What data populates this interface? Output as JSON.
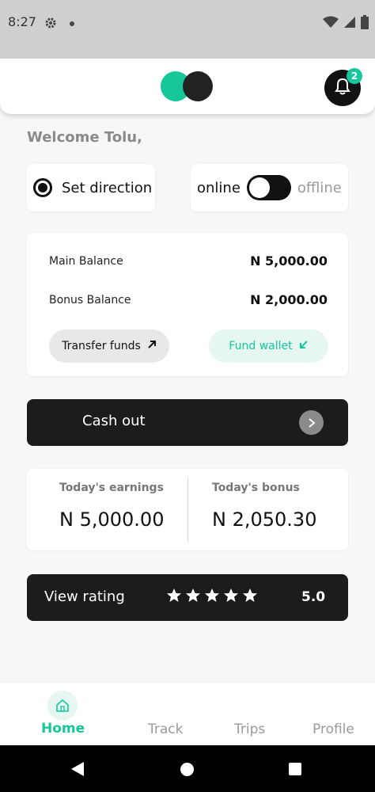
{
  "status_bar": {
    "time": "8:27",
    "icons": [
      "gear-icon",
      "dot-icon",
      "wifi-icon",
      "signal-icon",
      "battery-icon"
    ]
  },
  "header": {
    "logo": "app-logo",
    "notification_count": "2"
  },
  "welcome": "Welcome Tolu,",
  "direction": {
    "label": "Set direction",
    "selected": true
  },
  "status_toggle": {
    "online_label": "online",
    "offline_label": "offline",
    "state": "offline"
  },
  "balances": {
    "main_label": "Main Balance",
    "main_value": "N 5,000.00",
    "bonus_label": "Bonus Balance",
    "bonus_value": "N 2,000.00",
    "transfer_label": "Transfer funds",
    "fund_label": "Fund wallet"
  },
  "cashout": {
    "label": "Cash out"
  },
  "earnings": {
    "today_earnings_label": "Today's earnings",
    "today_earnings_value": "N 5,000.00",
    "today_bonus_label": "Today's bonus",
    "today_bonus_value": "N 2,050.30"
  },
  "rating": {
    "label": "View rating",
    "stars": 5,
    "value": "5.0"
  },
  "bottom_nav": {
    "items": [
      {
        "label": "Home",
        "active": true
      },
      {
        "label": "Track",
        "active": false
      },
      {
        "label": "Trips",
        "active": false
      },
      {
        "label": "Profile",
        "active": false
      }
    ]
  },
  "colors": {
    "accent": "#16c79a",
    "dark": "#1c1c1c",
    "background": "#f7f7f7"
  }
}
